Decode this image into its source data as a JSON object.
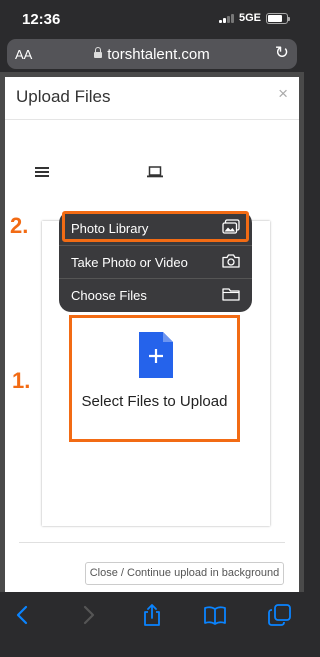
{
  "status_bar": {
    "time": "12:36",
    "network": "5GE"
  },
  "browser": {
    "text_size_label": "AA",
    "url": "torshtalent.com"
  },
  "modal": {
    "title": "Upload Files",
    "close_symbol": "×",
    "upload_area_label": "Select Files to Upload",
    "footer_button": "Close / Continue upload in background"
  },
  "share_menu": {
    "items": [
      {
        "label": "Photo Library",
        "icon": "photo-library-icon"
      },
      {
        "label": "Take Photo or Video",
        "icon": "camera-icon"
      },
      {
        "label": "Choose Files",
        "icon": "folder-icon"
      }
    ]
  },
  "annotations": {
    "step_1": "1.",
    "step_2": "2."
  },
  "colors": {
    "accent": "#f26b14",
    "file_icon": "#2563eb",
    "ios_blue": "#0a84ff"
  }
}
